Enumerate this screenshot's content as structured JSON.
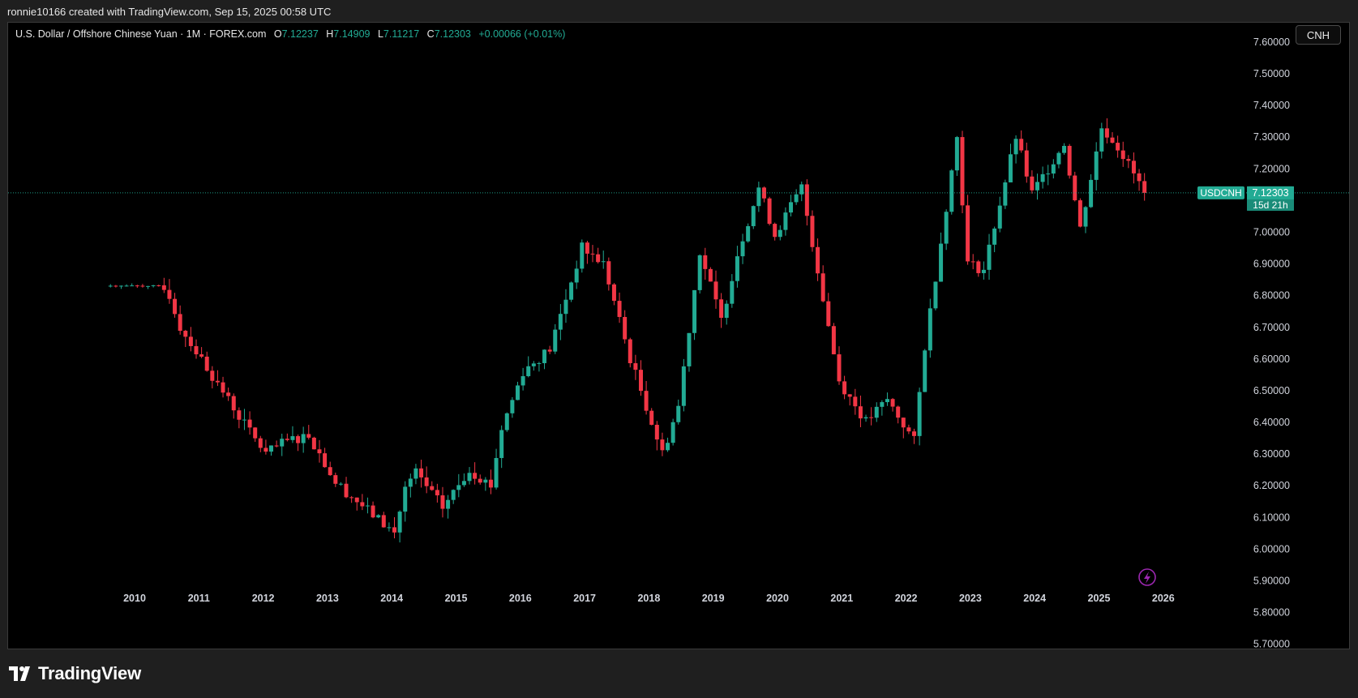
{
  "credit": "ronnie10166 created with TradingView.com, Sep 15, 2025 00:58 UTC",
  "legend": {
    "symbol": "U.S. Dollar / Offshore Chinese Yuan · 1M · FOREX.com",
    "open_label": "O",
    "open": "7.12237",
    "high_label": "H",
    "high": "7.14909",
    "low_label": "L",
    "low": "7.11217",
    "close_label": "C",
    "close": "7.12303",
    "change": "+0.00066 (+0.01%)"
  },
  "currency_button": "CNH",
  "price_tag": {
    "ticker": "USDCNH",
    "price": "7.12303",
    "countdown": "15d 21h"
  },
  "footer_brand": "TradingView",
  "colors": {
    "up": "#22ab94",
    "down": "#f23645",
    "background": "#000000",
    "axis_text": "#d1d4dc"
  },
  "chart_data": {
    "type": "candlestick",
    "symbol": "USDCNH",
    "interval": "1M",
    "x_ticks": [
      "2010",
      "2011",
      "2012",
      "2013",
      "2014",
      "2015",
      "2016",
      "2017",
      "2018",
      "2019",
      "2020",
      "2021",
      "2022",
      "2023",
      "2024",
      "2025",
      "2026"
    ],
    "y_ticks": [
      "7.60000",
      "7.50000",
      "7.40000",
      "7.30000",
      "7.20000",
      "7.10000",
      "7.00000",
      "6.90000",
      "6.80000",
      "6.70000",
      "6.60000",
      "6.50000",
      "6.40000",
      "6.30000",
      "6.20000",
      "6.10000",
      "6.00000",
      "5.90000",
      "5.80000",
      "5.70000"
    ],
    "ylim": [
      5.68,
      7.66
    ],
    "last_price": 7.12303,
    "anchors": [
      [
        "2009-08",
        6.83
      ],
      [
        "2010-05",
        6.83
      ],
      [
        "2010-07",
        6.8
      ],
      [
        "2010-09",
        6.7
      ],
      [
        "2011-04",
        6.52
      ],
      [
        "2011-10",
        6.37
      ],
      [
        "2012-01",
        6.3
      ],
      [
        "2012-05",
        6.34
      ],
      [
        "2012-09",
        6.36
      ],
      [
        "2013-02",
        6.21
      ],
      [
        "2013-06",
        6.15
      ],
      [
        "2014-01",
        6.05
      ],
      [
        "2014-03",
        6.19
      ],
      [
        "2014-05",
        6.24
      ],
      [
        "2014-10",
        6.13
      ],
      [
        "2015-03",
        6.25
      ],
      [
        "2015-07",
        6.2
      ],
      [
        "2015-09",
        6.38
      ],
      [
        "2016-01",
        6.56
      ],
      [
        "2016-06",
        6.63
      ],
      [
        "2016-12",
        6.95
      ],
      [
        "2017-04",
        6.9
      ],
      [
        "2017-09",
        6.6
      ],
      [
        "2018-03",
        6.3
      ],
      [
        "2018-06",
        6.45
      ],
      [
        "2018-10",
        6.94
      ],
      [
        "2019-02",
        6.72
      ],
      [
        "2019-05",
        6.93
      ],
      [
        "2019-09",
        7.14
      ],
      [
        "2019-12",
        6.99
      ],
      [
        "2020-05",
        7.14
      ],
      [
        "2020-12",
        6.53
      ],
      [
        "2021-05",
        6.4
      ],
      [
        "2021-09",
        6.47
      ],
      [
        "2022-02",
        6.34
      ],
      [
        "2022-04",
        6.64
      ],
      [
        "2022-10",
        7.3
      ],
      [
        "2022-12",
        6.9
      ],
      [
        "2023-03",
        6.88
      ],
      [
        "2023-09",
        7.3
      ],
      [
        "2023-12",
        7.12
      ],
      [
        "2024-06",
        7.28
      ],
      [
        "2024-09",
        7.01
      ],
      [
        "2025-01",
        7.33
      ],
      [
        "2025-04",
        7.27
      ],
      [
        "2025-09",
        7.12303
      ]
    ]
  }
}
